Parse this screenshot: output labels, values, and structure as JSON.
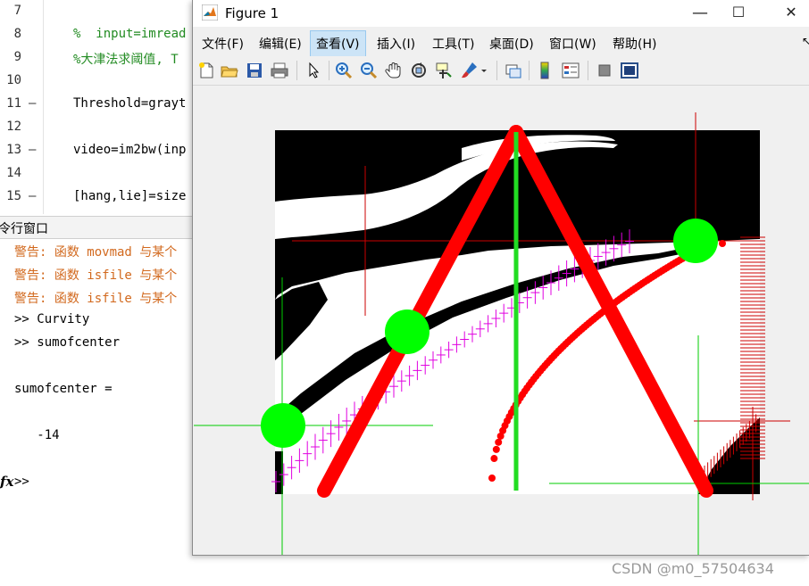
{
  "editor": {
    "lines": [
      {
        "num": "7",
        "dash": "",
        "code": "",
        "kind": "normal"
      },
      {
        "num": "8",
        "dash": "",
        "code": "%  input=imread",
        "kind": "comment"
      },
      {
        "num": "9",
        "dash": "",
        "code": "%大津法求阈值, T",
        "kind": "comment"
      },
      {
        "num": "10",
        "dash": "",
        "code": "",
        "kind": "normal"
      },
      {
        "num": "11",
        "dash": "—",
        "code": "Threshold=grayt",
        "kind": "normal"
      },
      {
        "num": "12",
        "dash": "",
        "code": "",
        "kind": "normal"
      },
      {
        "num": "13",
        "dash": "—",
        "code": "video=im2bw(inp",
        "kind": "normal"
      },
      {
        "num": "14",
        "dash": "",
        "code": "",
        "kind": "normal"
      },
      {
        "num": "15",
        "dash": "—",
        "code": "[hang,lie]=size",
        "kind": "normal"
      }
    ]
  },
  "command_window": {
    "header": "令行窗口",
    "lines": [
      {
        "text": "警告: 函数 movmad 与某个",
        "kind": "warn"
      },
      {
        "text": "警告: 函数 isfile 与某个",
        "kind": "warn"
      },
      {
        "text": "警告: 函数 isfile 与某个",
        "kind": "warn"
      },
      {
        "text": ">> Curvity",
        "kind": "normal"
      },
      {
        "text": ">> sumofcenter",
        "kind": "normal"
      },
      {
        "text": "",
        "kind": "normal"
      },
      {
        "text": "sumofcenter =",
        "kind": "normal"
      },
      {
        "text": "",
        "kind": "normal"
      },
      {
        "text": "   -14",
        "kind": "normal"
      },
      {
        "text": "",
        "kind": "normal"
      },
      {
        "text": ">>",
        "kind": "normal"
      }
    ],
    "fx_symbol": "fx"
  },
  "figure": {
    "title": "Figure 1",
    "window_buttons": {
      "minimize": "—",
      "maximize": "☐",
      "close": "✕"
    },
    "menu": [
      "文件(F)",
      "编辑(E)",
      "查看(V)",
      "插入(I)",
      "工具(T)",
      "桌面(D)",
      "窗口(W)",
      "帮助(H)"
    ],
    "active_menu": "查看(V)",
    "menu_more": "↖",
    "toolbar_icons": [
      "new-figure-icon",
      "open-file-icon",
      "save-icon",
      "print-icon",
      "pointer-icon",
      "zoom-in-icon",
      "zoom-out-icon",
      "pan-icon",
      "rotate-icon",
      "data-cursor-icon",
      "brush-icon",
      "link-plot-icon",
      "colorbar-icon",
      "legend-icon",
      "hide-plot-tools-icon",
      "show-plot-tools-icon"
    ],
    "colors": {
      "red": "#ff0000",
      "green": "#00ff00",
      "magenta": "#e000e0",
      "dark_red": "#cc0000",
      "black": "#000000"
    }
  },
  "watermark": "CSDN @m0_57504634"
}
